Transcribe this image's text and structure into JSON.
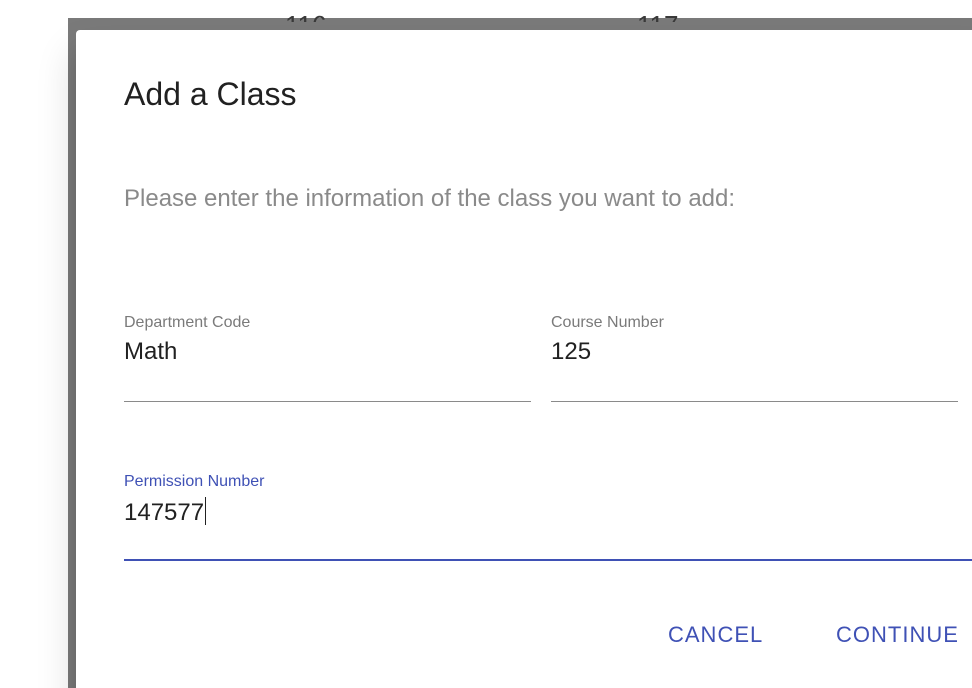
{
  "background": {
    "peek_left": "116",
    "peek_right": "117"
  },
  "dialog": {
    "title": "Add a Class",
    "text": "Please enter the information of the class you want to add:",
    "fields": {
      "department": {
        "label": "Department Code",
        "value": "Math"
      },
      "course": {
        "label": "Course Number",
        "value": "125"
      },
      "permission": {
        "label": "Permission Number",
        "value": "147577",
        "focused": true
      }
    },
    "actions": {
      "cancel": "CANCEL",
      "continue": "CONTINUE"
    }
  },
  "colors": {
    "accent": "#3f51b5",
    "backdrop": "#7a7a7a",
    "text_primary": "#212121",
    "text_secondary": "#8a8a8a"
  }
}
